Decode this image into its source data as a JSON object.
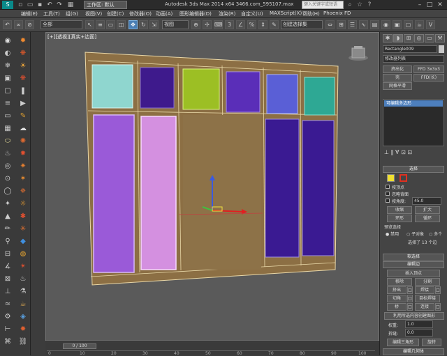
{
  "title_bar": {
    "workspace": "工作区: 默认",
    "app_title": "Autodesk 3ds Max  2014 x64       3466.com_595107.max",
    "search_placeholder": "键入关键字或短语",
    "min": "–",
    "max": "□",
    "close": "✕"
  },
  "menu": [
    "编辑(E)",
    "工具(T)",
    "组(G)",
    "视图(V)",
    "创建(C)",
    "修改器(O)",
    "动画(A)",
    "图形编辑器(D)",
    "渲染(R)",
    "自定义(U)",
    "MAXScript(X)",
    "帮助(H)",
    "Phoenix FD"
  ],
  "toolbar": {
    "filter_select": "全部",
    "view_select": "视图",
    "selection_set": "创建选择集"
  },
  "viewport": {
    "label": "[+][透视][真实+边面]"
  },
  "timeline": {
    "frame": "0 / 100",
    "ticks": [
      "0",
      "10",
      "20",
      "30",
      "40",
      "50",
      "60",
      "70",
      "80",
      "90",
      "100"
    ]
  },
  "command_panel": {
    "object_name": "Rectangle009",
    "modifier_list": "修改器列表",
    "buttons_row1": [
      "挤出化",
      "FFD 3x3x3"
    ],
    "buttons_row2": [
      "壳",
      "FFD(长)"
    ],
    "buttons_row3": [
      "网格平滑"
    ],
    "stack_item": "可编辑多边形",
    "selection_rollout": "选择",
    "by_vertex": "按顶点",
    "ignore_backfacing": "忽略背面",
    "by_angle": "按角度:",
    "angle_value": "45.0",
    "shrink": "收缩",
    "grow": "扩大",
    "ring": "环形",
    "loop": "循环",
    "preview_selection": "预览选择",
    "preview_off": "禁用",
    "preview_subobject": "子对象",
    "preview_multi": "多个",
    "selected_count": "选择了 13 个边",
    "soft_selection": "软选择",
    "edit_edges": "编辑边",
    "insert_vertex": "插入顶点",
    "remove": "移除",
    "split": "分割",
    "extrude": "挤出",
    "weld": "焊接",
    "chamfer": "切角",
    "target_weld": "目标焊接",
    "bridge": "桥",
    "connect": "连接",
    "create_shape": "利用所选内容创建图形",
    "weight_label": "权重:",
    "weight_value": "1.0",
    "crease_label": "折缝:",
    "crease_value": "0.0",
    "edit_tri": "编辑三角形",
    "rotate": "旋转",
    "edit_geo": "编辑几何体"
  },
  "colors": {
    "accent": "#4d7fbd",
    "door_frame": "#8c6f44",
    "panel_teal": "#8fd6cf",
    "panel_indigo": "#3e1a8c",
    "panel_lime": "#9cbf24",
    "panel_violet": "#5a2eb8",
    "panel_blue": "#5a5fd6",
    "panel_green": "#2ea894",
    "panel_lavender": "#9a5ad8",
    "panel_pink": "#d490e0",
    "panel_deep": "#3a1a92"
  }
}
